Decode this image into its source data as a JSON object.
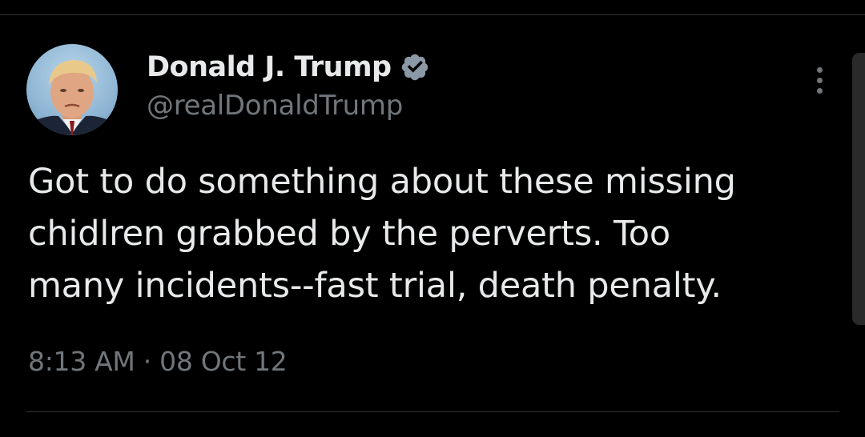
{
  "tweet": {
    "author": {
      "display_name": "Donald J. Trump",
      "handle": "@realDonaldTrump",
      "verified": true,
      "verified_badge_color": "#1d9bf0"
    },
    "text_lines": [
      "Got to do something about these missing",
      "chidlren grabbed by the perverts. Too",
      "many incidents--fast trial, death penalty."
    ],
    "time": "8:13 AM",
    "separator": "·",
    "date": "08 Oct 12",
    "more_menu_icon": "more-vertical-icon"
  },
  "colors": {
    "background": "#000000",
    "primary_text": "#e7e9ea",
    "secondary_text": "#71767b",
    "divider": "#2f3336"
  }
}
